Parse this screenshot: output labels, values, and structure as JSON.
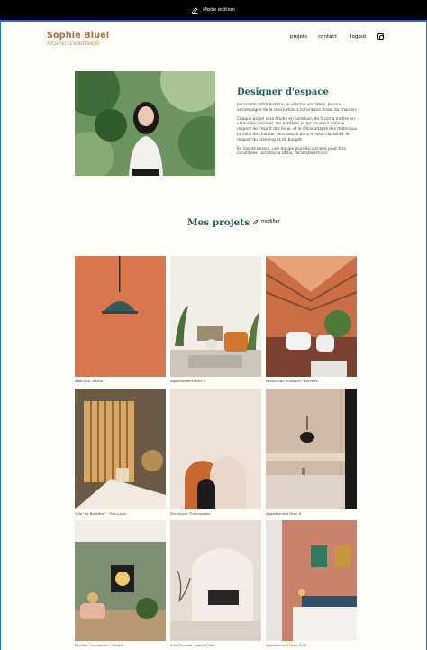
{
  "edit_bar": {
    "label": "Mode édition"
  },
  "brand": {
    "title": "Sophie Bluel",
    "subtitle": "ARCHITECTE D'INTÉRIEUR"
  },
  "nav": {
    "projets": "projets",
    "contact": "contact",
    "logout": "logout",
    "instagram_icon": "instagram-icon"
  },
  "intro": {
    "title": "Designer d'espace",
    "paragraphs": [
      "Je raconte votre histoire, je valorise vos idées. Je vous accompagne de la conception à la livraison finale du chantier.",
      "Chaque projet sera étudié en commun, de façon à mettre en valeur les volumes, les matières et les couleurs dans le respect de l'esprit des lieux, et le choix adapté des matériaux. Le suivi du chantier sera assuré dans le souci du détail, le respect du planning et du budget.",
      "En cas de besoin, une équipe pluridisciplinaire peut être constituée : architecte DPLG, décorateur(trice)"
    ]
  },
  "projects": {
    "title": "Mes projets",
    "modify_label": "modifier",
    "items": [
      {
        "caption": "Abat-jour Tahina"
      },
      {
        "caption": "Appartement Paris V"
      },
      {
        "caption": "Restaurant Sushisen - Londres"
      },
      {
        "caption": "Villa \"La Balisière\" - Port-Louis"
      },
      {
        "caption": "Structures Thermopolis"
      },
      {
        "caption": "Appartement Paris X"
      },
      {
        "caption": "Pavillon \"Le coteau\" - Cassis"
      },
      {
        "caption": "Villa Ferneze - Isola d'Elba"
      },
      {
        "caption": "Appartement Paris XVIII"
      }
    ]
  },
  "colors": {
    "brand": "#b1663c",
    "accent": "#1d6154",
    "banner": "#000000",
    "background": "#fffef8"
  }
}
